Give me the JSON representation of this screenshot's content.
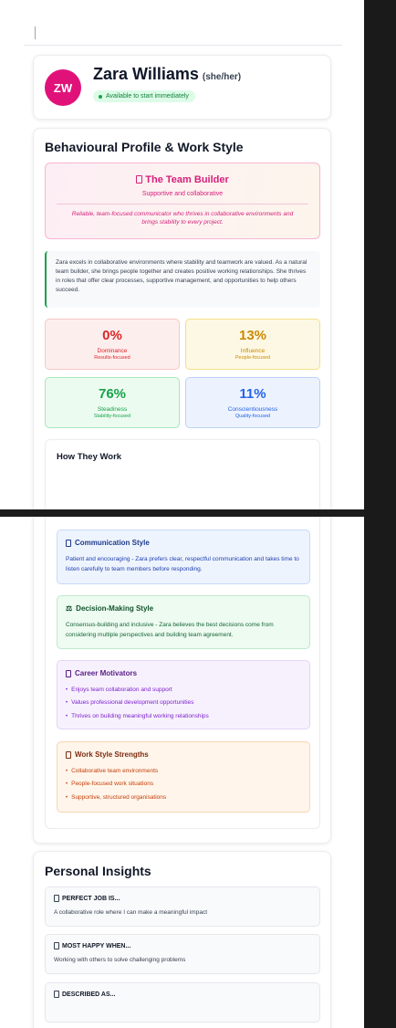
{
  "profile": {
    "initials": "ZW",
    "name": "Zara Williams",
    "pronouns": "(she/her)",
    "availability": "Available to start immediately"
  },
  "behaviour": {
    "title": "Behavioural Profile & Work Style",
    "type_icon": "tofu-box-icon",
    "type_title": "The Team Builder",
    "type_subtitle": "Supportive and collaborative",
    "type_description": "Reliable, team-focused communicator who thrives in collaborative environments and brings stability to every project.",
    "summary": "Zara excels in collaborative environments where stability and teamwork are valued. As a natural team builder, she brings people together and creates positive working relationships. She thrives in roles that offer clear processes, supportive management, and opportunities to help others succeed.",
    "disc": [
      {
        "percent": "0%",
        "label": "Dominance",
        "sub": "Results-focused",
        "color": "#dc2626"
      },
      {
        "percent": "13%",
        "label": "Influence",
        "sub": "People-focused",
        "color": "#ca8a04"
      },
      {
        "percent": "76%",
        "label": "Steadiness",
        "sub": "Stability-focused",
        "color": "#16a34a"
      },
      {
        "percent": "11%",
        "label": "Conscientiousness",
        "sub": "Quality-focused",
        "color": "#2563eb"
      }
    ]
  },
  "how": {
    "title": "How They Work",
    "communication": {
      "title": "Communication Style",
      "text": "Patient and encouraging - Zara prefers clear, respectful communication and takes time to listen carefully to team members before responding."
    },
    "decision": {
      "title": "Decision-Making Style",
      "icon": "⚖",
      "text": "Consensus-building and inclusive - Zara believes the best decisions come from considering multiple perspectives and building team agreement."
    },
    "motivators": {
      "title": "Career Motivators",
      "items": [
        "Enjoys team collaboration and support",
        "Values professional development opportunities",
        "Thrives on building meaningful working relationships"
      ]
    },
    "strengths": {
      "title": "Work Style Strengths",
      "items": [
        "Collaborative team environments",
        "People-focused work situations",
        "Supportive, structured organisations"
      ]
    }
  },
  "insights": {
    "title": "Personal Insights",
    "items": [
      {
        "title": "PERFECT JOB IS...",
        "text": "A collaborative role where I can make a meaningful impact"
      },
      {
        "title": "MOST HAPPY WHEN...",
        "text": "Working with others to solve challenging problems"
      },
      {
        "title": "DESCRIBED AS...",
        "text": ""
      }
    ]
  }
}
